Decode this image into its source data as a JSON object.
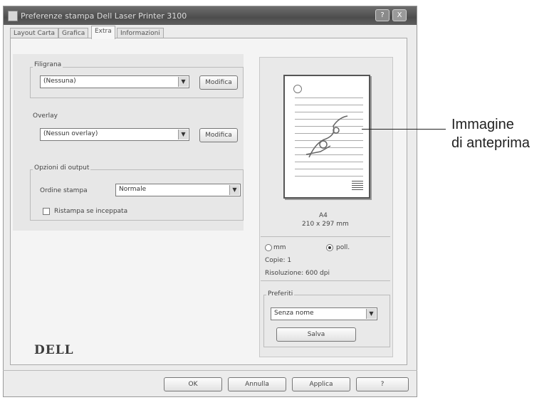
{
  "window": {
    "title": "Preferenze stampa Dell Laser Printer 3100",
    "buttons": [
      "?",
      "X"
    ]
  },
  "tabs": [
    {
      "label": "Layout Carta"
    },
    {
      "label": "Grafica"
    },
    {
      "label": "Extra"
    },
    {
      "label": "Informazioni"
    }
  ],
  "watermark": {
    "group_label": "Filigrana",
    "value": "(Nessuna)",
    "edit_label": "Modifica"
  },
  "overlay": {
    "group_label": "Overlay",
    "value": "(Nessun overlay)",
    "edit_label": "Modifica"
  },
  "output_options": {
    "group_label": "Opzioni di output",
    "order_label": "Ordine stampa",
    "order_value": "Normale",
    "reprint_label": "Ristampa se inceppata"
  },
  "preview": {
    "paper_name": "A4",
    "paper_size": "210 x 297 mm",
    "unit_inch": "mm",
    "unit_mm": "poll.",
    "copies": "Copie: 1",
    "resolution": "Risoluzione: 600 dpi"
  },
  "favorites": {
    "group_label": "Preferiti",
    "value": "Senza nome",
    "save_label": "Salva"
  },
  "brand": "DELL",
  "footer": {
    "ok_label": "OK",
    "cancel_label": "Annulla",
    "apply_label": "Applica",
    "help_label": "?"
  },
  "annotation": {
    "line1": "Immagine",
    "line2": "di anteprima"
  }
}
